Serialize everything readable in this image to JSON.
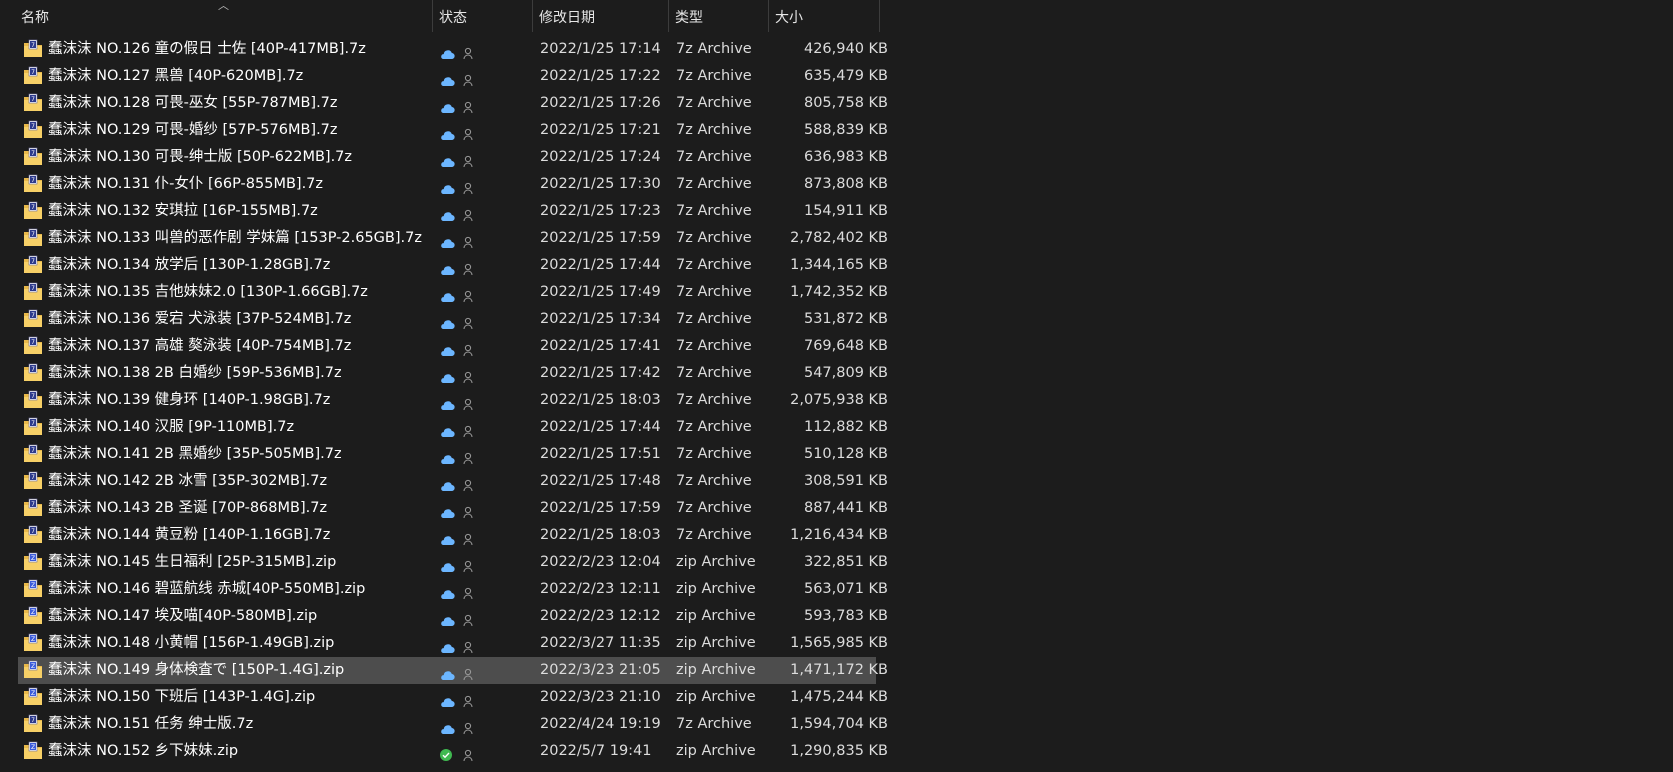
{
  "columns": {
    "name": "名称",
    "status": "状态",
    "modified": "修改日期",
    "type": "类型",
    "size": "大小"
  },
  "colors": {
    "background": "#1c1c1c",
    "selected_row": "#4d4d4d",
    "cloud": "#6cb6ff",
    "synced": "#3fb950"
  },
  "files": [
    {
      "name": "蠢沫沫 NO.126 童の假日 士佐 [40P-417MB].7z",
      "status": "cloud-icon",
      "date": "2022/1/25 17:14",
      "type": "7z Archive",
      "size": "426,940 KB"
    },
    {
      "name": "蠢沫沫 NO.127 黑兽 [40P-620MB].7z",
      "status": "cloud-icon",
      "date": "2022/1/25 17:22",
      "type": "7z Archive",
      "size": "635,479 KB"
    },
    {
      "name": "蠢沫沫 NO.128 可畏-巫女 [55P-787MB].7z",
      "status": "cloud-icon",
      "date": "2022/1/25 17:26",
      "type": "7z Archive",
      "size": "805,758 KB"
    },
    {
      "name": "蠢沫沫 NO.129 可畏-婚纱 [57P-576MB].7z",
      "status": "cloud-icon",
      "date": "2022/1/25 17:21",
      "type": "7z Archive",
      "size": "588,839 KB"
    },
    {
      "name": "蠢沫沫 NO.130 可畏-绅士版 [50P-622MB].7z",
      "status": "cloud-icon",
      "date": "2022/1/25 17:24",
      "type": "7z Archive",
      "size": "636,983 KB"
    },
    {
      "name": "蠢沫沫 NO.131 仆-女仆 [66P-855MB].7z",
      "status": "cloud-icon",
      "date": "2022/1/25 17:30",
      "type": "7z Archive",
      "size": "873,808 KB"
    },
    {
      "name": "蠢沫沫 NO.132 安琪拉 [16P-155MB].7z",
      "status": "cloud-icon",
      "date": "2022/1/25 17:23",
      "type": "7z Archive",
      "size": "154,911 KB"
    },
    {
      "name": "蠢沫沫 NO.133 叫兽的恶作剧 学妹篇 [153P-2.65GB].7z",
      "status": "cloud-icon",
      "date": "2022/1/25 17:59",
      "type": "7z Archive",
      "size": "2,782,402 KB"
    },
    {
      "name": "蠢沫沫 NO.134 放学后 [130P-1.28GB].7z",
      "status": "cloud-icon",
      "date": "2022/1/25 17:44",
      "type": "7z Archive",
      "size": "1,344,165 KB"
    },
    {
      "name": "蠢沫沫 NO.135 吉他妹妹2.0 [130P-1.66GB].7z",
      "status": "cloud-icon",
      "date": "2022/1/25 17:49",
      "type": "7z Archive",
      "size": "1,742,352 KB"
    },
    {
      "name": "蠢沫沫 NO.136 爱宕 犬泳装 [37P-524MB].7z",
      "status": "cloud-icon",
      "date": "2022/1/25 17:34",
      "type": "7z Archive",
      "size": "531,872 KB"
    },
    {
      "name": "蠢沫沫 NO.137 高雄 獒泳装 [40P-754MB].7z",
      "status": "cloud-icon",
      "date": "2022/1/25 17:41",
      "type": "7z Archive",
      "size": "769,648 KB"
    },
    {
      "name": "蠢沫沫 NO.138 2B 白婚纱 [59P-536MB].7z",
      "status": "cloud-icon",
      "date": "2022/1/25 17:42",
      "type": "7z Archive",
      "size": "547,809 KB"
    },
    {
      "name": "蠢沫沫 NO.139 健身环 [140P-1.98GB].7z",
      "status": "cloud-icon",
      "date": "2022/1/25 18:03",
      "type": "7z Archive",
      "size": "2,075,938 KB"
    },
    {
      "name": "蠢沫沫 NO.140 汉服 [9P-110MB].7z",
      "status": "cloud-icon",
      "date": "2022/1/25 17:44",
      "type": "7z Archive",
      "size": "112,882 KB"
    },
    {
      "name": "蠢沫沫 NO.141 2B 黑婚纱 [35P-505MB].7z",
      "status": "cloud-icon",
      "date": "2022/1/25 17:51",
      "type": "7z Archive",
      "size": "510,128 KB"
    },
    {
      "name": "蠢沫沫 NO.142 2B 冰雪 [35P-302MB].7z",
      "status": "cloud-icon",
      "date": "2022/1/25 17:48",
      "type": "7z Archive",
      "size": "308,591 KB"
    },
    {
      "name": "蠢沫沫 NO.143 2B 圣诞 [70P-868MB].7z",
      "status": "cloud-icon",
      "date": "2022/1/25 17:59",
      "type": "7z Archive",
      "size": "887,441 KB"
    },
    {
      "name": "蠢沫沫 NO.144 黄豆粉 [140P-1.16GB].7z",
      "status": "cloud-icon",
      "date": "2022/1/25 18:03",
      "type": "7z Archive",
      "size": "1,216,434 KB"
    },
    {
      "name": "蠢沫沫 NO.145 生日福利 [25P-315MB].zip",
      "status": "cloud-icon",
      "date": "2022/2/23 12:04",
      "type": "zip Archive",
      "size": "322,851 KB"
    },
    {
      "name": "蠢沫沫 NO.146 碧蓝航线 赤城[40P-550MB].zip",
      "status": "cloud-icon",
      "date": "2022/2/23 12:11",
      "type": "zip Archive",
      "size": "563,071 KB"
    },
    {
      "name": "蠢沫沫 NO.147 埃及喵[40P-580MB].zip",
      "status": "cloud-icon",
      "date": "2022/2/23 12:12",
      "type": "zip Archive",
      "size": "593,783 KB"
    },
    {
      "name": "蠢沫沫 NO.148 小黄帽 [156P-1.49GB].zip",
      "status": "cloud-icon",
      "date": "2022/3/27 11:35",
      "type": "zip Archive",
      "size": "1,565,985 KB"
    },
    {
      "name": "蠢沫沫 NO.149 身体検査で [150P-1.4G].zip",
      "status": "cloud-icon",
      "date": "2022/3/23 21:05",
      "type": "zip Archive",
      "size": "1,471,172 KB",
      "selected": true
    },
    {
      "name": "蠢沫沫 NO.150 下班后 [143P-1.4G].zip",
      "status": "cloud-icon",
      "date": "2022/3/23 21:10",
      "type": "zip Archive",
      "size": "1,475,244 KB"
    },
    {
      "name": "蠢沫沫 NO.151 任务 绅士版.7z",
      "status": "cloud-icon",
      "date": "2022/4/24 19:19",
      "type": "7z Archive",
      "size": "1,594,704 KB"
    },
    {
      "name": "蠢沫沫 NO.152 乡下妹妹.zip",
      "status": "synced-check-icon",
      "date": "2022/5/7 19:41",
      "type": "zip Archive",
      "size": "1,290,835 KB"
    }
  ]
}
